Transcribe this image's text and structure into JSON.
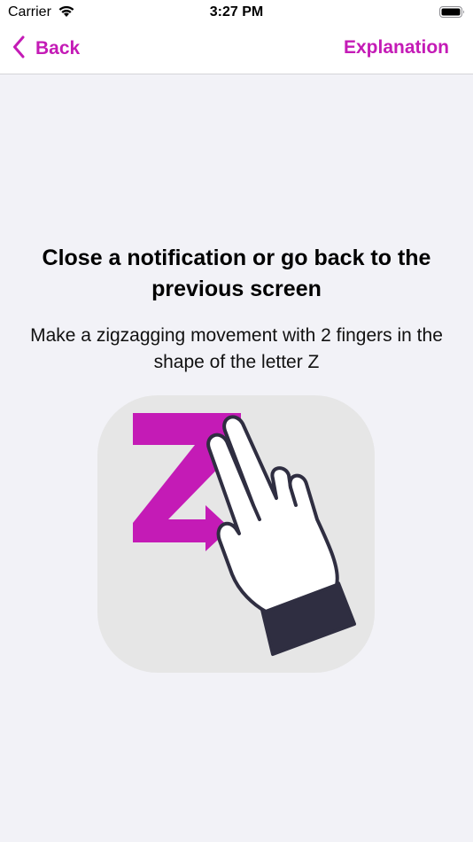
{
  "status_bar": {
    "carrier": "Carrier",
    "time": "3:27 PM",
    "wifi_icon": "wifi-icon",
    "battery_icon": "battery-icon"
  },
  "nav": {
    "back_label": "Back",
    "back_icon": "chevron-left-icon",
    "explanation_label": "Explanation"
  },
  "gesture": {
    "title": "Close a notification or go back to the previous screen",
    "description": "Make a zigzagging movement with 2 fingers in the shape of the letter Z",
    "illustration_icon": "two-finger-z-gesture-icon"
  },
  "colors": {
    "accent": "#c41bb6",
    "background": "#f2f2f7",
    "tile": "#e6e6e6",
    "sleeve": "#2f2e41"
  }
}
